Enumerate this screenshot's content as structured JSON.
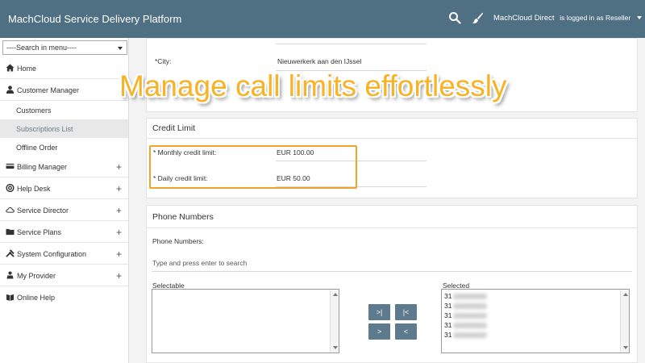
{
  "app": {
    "title": "MachCloud Service Delivery Platform"
  },
  "header": {
    "user_name": "MachCloud Direct",
    "role_text": "is logged in as Reseller",
    "icons": [
      "search-icon",
      "paintbrush-icon",
      "caret-down-icon"
    ]
  },
  "sidebar": {
    "search": "----Search in menu----",
    "items": {
      "home": "Home",
      "customer_manager": "Customer Manager",
      "customers": "Customers",
      "subscriptions_list": "Subscriptions List",
      "offline_order": "Offline Order",
      "billing_manager": "Billing Manager",
      "help_desk": "Help Desk",
      "service_director": "Service Director",
      "service_plans": "Service Plans",
      "system_configuration": "System Configuration",
      "my_provider": "My Provider",
      "online_help": "Online Help"
    },
    "plus": "+"
  },
  "address": {
    "city_label": "*City:",
    "city_value": "Nieuwerkerk aan den IJssel"
  },
  "credit": {
    "title": "Credit Limit",
    "monthly_label": "* Monthly credit limit:",
    "monthly_value": "EUR 100.00",
    "daily_label": "* Daily credit limit:",
    "daily_value": "EUR 50.00"
  },
  "overlay": {
    "text": "Manage call limits effortlessly",
    "color": "#f7b325"
  },
  "phone": {
    "title": "Phone Numbers",
    "label": "Phone Numbers:",
    "search_placeholder": "Type and press enter to search",
    "selectable_label": "Selectable",
    "selected_label": "Selected",
    "selected_items": [
      "31",
      "31",
      "31",
      "31",
      "31"
    ],
    "buttons": {
      "add_all": ">|",
      "remove_all": "|<",
      "add": ">",
      "remove": "<"
    }
  },
  "colors": {
    "topbar": "#4f6f83",
    "accent_button": "#5d7a8e",
    "highlight_border": "#f0a52a"
  }
}
